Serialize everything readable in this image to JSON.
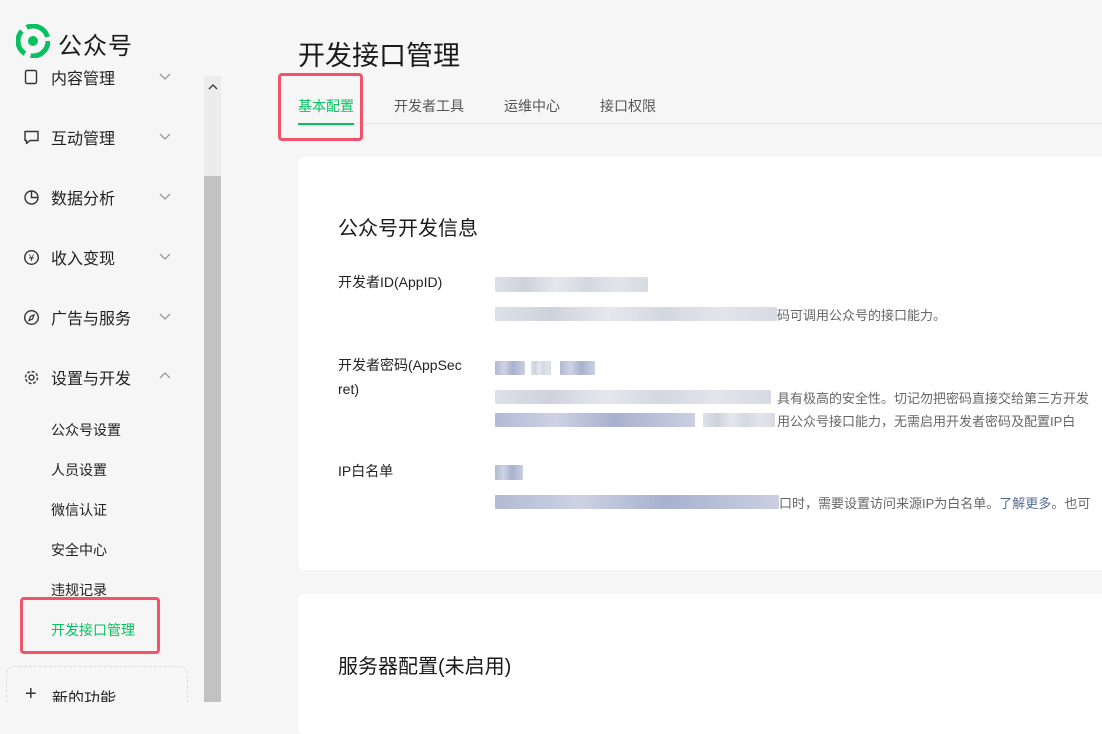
{
  "app": {
    "name": "公众号",
    "brand_color": "#07c160"
  },
  "sidebar": {
    "partial_item": {
      "label": "内容管理",
      "icon": "document-icon"
    },
    "items": [
      {
        "label": "互动管理",
        "icon": "chat-icon",
        "expanded": false
      },
      {
        "label": "数据分析",
        "icon": "pie-chart-icon",
        "expanded": false
      },
      {
        "label": "收入变现",
        "icon": "yen-circle-icon",
        "expanded": false
      },
      {
        "label": "广告与服务",
        "icon": "compass-icon",
        "expanded": false
      },
      {
        "label": "设置与开发",
        "icon": "gear-icon",
        "expanded": true
      }
    ],
    "sub_items": [
      {
        "label": "公众号设置",
        "active": false
      },
      {
        "label": "人员设置",
        "active": false
      },
      {
        "label": "微信认证",
        "active": false
      },
      {
        "label": "安全中心",
        "active": false
      },
      {
        "label": "违规记录",
        "active": false
      },
      {
        "label": "开发接口管理",
        "active": true
      }
    ],
    "new_feature": {
      "label": "新的功能"
    }
  },
  "main": {
    "title": "开发接口管理",
    "tabs": [
      {
        "label": "基本配置",
        "active": true
      },
      {
        "label": "开发者工具",
        "active": false
      },
      {
        "label": "运维中心",
        "active": false
      },
      {
        "label": "接口权限",
        "active": false
      }
    ],
    "dev_info": {
      "title": "公众号开发信息",
      "appid": {
        "label": "开发者ID(AppID)",
        "desc_tail": "码可调用公众号的接口能力。"
      },
      "appsecret": {
        "label_line1": "开发者密码(AppSec",
        "label_line2": "ret)",
        "desc_tail_1": "具有极高的安全性。切记勿把密码直接交给第三方开发",
        "desc_tail_2": "用公众号接口能力，无需启用开发者密码及配置IP白"
      },
      "ip_whitelist": {
        "label": "IP白名单",
        "desc_tail": "口时，需要设置访问来源IP为白名单。",
        "learn_more": "了解更多",
        "desc_after": "。也可"
      }
    },
    "server_config": {
      "title": "服务器配置(未启用)"
    }
  },
  "colors": {
    "active_green": "#07c160",
    "highlight_red": "#f0536a",
    "link_blue": "#576b95"
  }
}
